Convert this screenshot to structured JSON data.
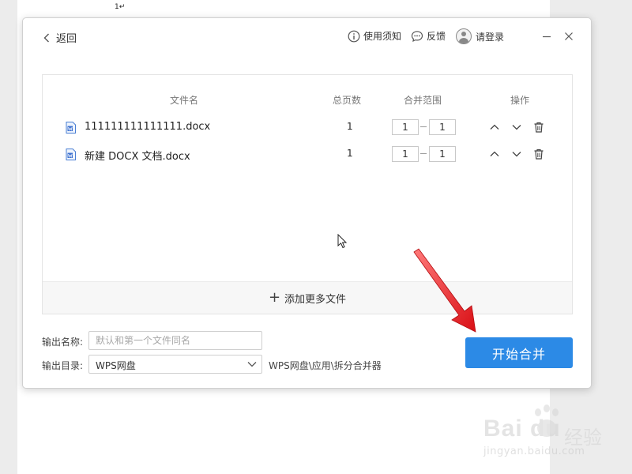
{
  "document": {
    "text": "1↵"
  },
  "titlebar": {
    "back_label": "返回",
    "usage_label": "使用须知",
    "feedback_label": "反馈",
    "login_label": "请登录"
  },
  "table": {
    "headers": {
      "filename": "文件名",
      "pages": "总页数",
      "range": "合并范围",
      "actions": "操作"
    },
    "rows": [
      {
        "filename": "111111111111111.docx",
        "pages": "1",
        "range_start": "1",
        "range_end": "1"
      },
      {
        "filename": "新建 DOCX 文档.docx",
        "pages": "1",
        "range_start": "1",
        "range_end": "1"
      }
    ],
    "add_more_label": "添加更多文件"
  },
  "form": {
    "output_name_label": "输出名称:",
    "output_name_placeholder": "默认和第一个文件同名",
    "output_dir_label": "输出目录:",
    "output_dir_value": "WPS网盘",
    "output_dir_path": "WPS网盘\\应用\\拆分合并器"
  },
  "start_button_label": "开始合并",
  "watermark": {
    "logo": "Bai du",
    "brand": "经验",
    "url": "jingyan.baidu.com"
  },
  "colors": {
    "primary": "#2c8ae6",
    "annotation_arrow": "#e8151b"
  }
}
